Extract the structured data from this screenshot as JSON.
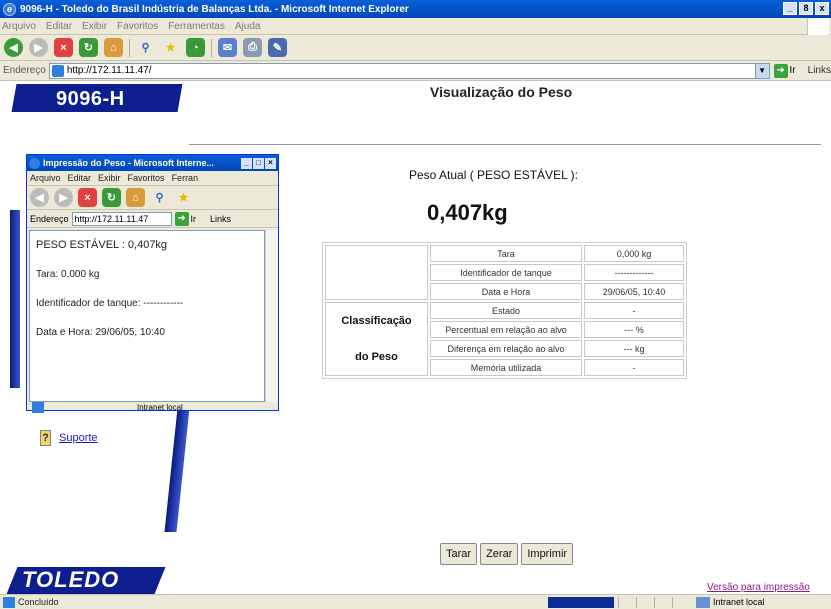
{
  "window": {
    "title": "9096-H - Toledo do Brasil Indústria de Balanças Ltda. - Microsoft Internet Explorer",
    "controls": [
      "_",
      "8",
      "x"
    ]
  },
  "menu": [
    "Arquivo",
    "Editar",
    "Exibir",
    "Favoritos",
    "Ferramentas",
    "Ajuda"
  ],
  "address": {
    "label": "Endereço",
    "url": "http://172.11.11.47/",
    "go_label": "Ir",
    "links_label": "Links"
  },
  "page": {
    "logo_top": "9096-H",
    "title": "Visualização do Peso",
    "peso_label": "Peso Atual ( PESO ESTÁVEL ):",
    "peso_value": "0,407kg",
    "suporte_label": "Suporte",
    "logo_bottom": "TOLEDO",
    "print_link": "Versão para impressão"
  },
  "table": {
    "classif_line1": "Classificação",
    "classif_line2": "do Peso",
    "rows": [
      {
        "label": "Tara",
        "value": "0,000 kg"
      },
      {
        "label": "Identificador de tanque",
        "value": "-------------"
      },
      {
        "label": "Data e Hora",
        "value": "29/06/05, 10:40"
      },
      {
        "label": "Estado",
        "value": "-"
      },
      {
        "label": "Percentual em relação ao alvo",
        "value": "--- %"
      },
      {
        "label": "Diferença em relação ao alvo",
        "value": "--- kg"
      },
      {
        "label": "Memória utilizada",
        "value": "-"
      }
    ]
  },
  "buttons": {
    "tarar": "Tarar",
    "zerar": "Zerar",
    "imprimir": "Imprimir"
  },
  "status": {
    "text": "Concluído",
    "zone": "Intranet local"
  },
  "popup": {
    "title": "Impressão do Peso - Microsoft Interne...",
    "menu": [
      "Arquivo",
      "Editar",
      "Exibir",
      "Favoritos",
      "Ferran"
    ],
    "address_label": "Endereço",
    "url": "http://172.11.11.47",
    "go_label": "Ir",
    "links_label": "Links",
    "lines": [
      "PESO ESTÁVEL : 0,407kg",
      "Tara: 0,000 kg",
      "Identificador de tanque: ------------",
      "Data e Hora: 29/06/05, 10:40"
    ],
    "status_zone": "Intranet local"
  }
}
